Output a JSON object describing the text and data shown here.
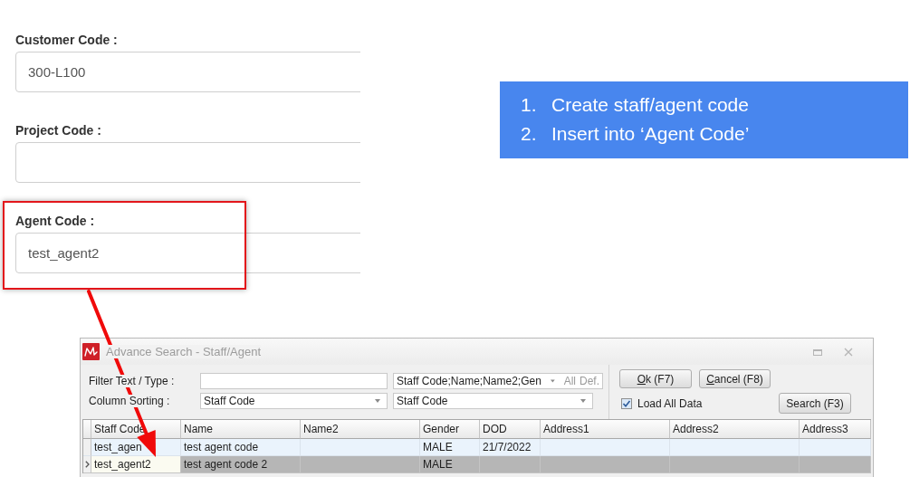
{
  "form": {
    "fields": [
      {
        "label": "Customer Code :",
        "value": "300-L100",
        "highlighted": false
      },
      {
        "label": "Project Code :",
        "highlighted": false
      },
      {
        "label": "Agent Code :",
        "value": "test_agent2",
        "highlighted": true
      }
    ]
  },
  "callout": {
    "items": [
      {
        "number": "1.",
        "text": "Create staff/agent code"
      },
      {
        "number": "2.",
        "text": "Insert into ‘Agent Code’"
      }
    ]
  },
  "dialog": {
    "title": "Advance Search - Staff/Agent",
    "filter": {
      "label": "Filter Text / Type :",
      "columns": "Staff Code;Name;Name2;Gen",
      "all": "All",
      "def": "Def."
    },
    "sorting": {
      "label": "Column Sorting :",
      "field_1": "Staff Code",
      "field_2": "Staff Code"
    },
    "buttons": [
      "Ok (F7)",
      "Cancel (F8)"
    ],
    "load_all": {
      "label": "Load All Data",
      "checked": true
    },
    "search_button": "Search (F3)",
    "table": {
      "columns": [
        "Staff Code",
        "Name",
        "Name2",
        "Gender",
        "DOD",
        "Address1",
        "Address2",
        "Address3"
      ],
      "rows": [
        {
          "staff_code": "test_agen",
          "name": "test agent code",
          "gender": "MALE",
          "dod": "21/7/2022",
          "selected": false
        },
        {
          "staff_code": "test_agent2",
          "name": "test agent code 2",
          "gender": "MALE",
          "selected": true
        }
      ]
    }
  }
}
